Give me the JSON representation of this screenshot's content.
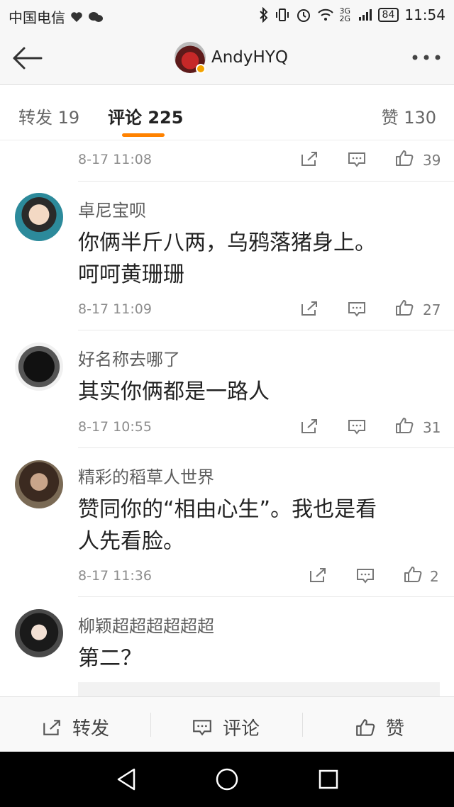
{
  "status_bar": {
    "carrier": "中国电信",
    "network": "3G 2G",
    "battery": "84",
    "time": "11:54"
  },
  "header": {
    "username": "AndyHYQ",
    "back_icon": "arrow-left-icon",
    "more_icon": "more-dots-icon"
  },
  "tabs": {
    "repost": "转发 19",
    "comment": "评论 225",
    "like": "赞 130",
    "accent": "#ff8200"
  },
  "first_partial": {
    "time": "8-17 11:08",
    "likes": "39"
  },
  "comments": [
    {
      "user": "卓尼宝呗",
      "line1": "你俩半斤八两，乌鸦落猪身上。",
      "line2": "呵呵黄珊珊",
      "time": "8-17 11:09",
      "likes": "27"
    },
    {
      "user": "好名称去哪了",
      "line1": "其实你俩都是一路人",
      "line2": "",
      "time": "8-17 10:55",
      "likes": "31"
    },
    {
      "user": "精彩的稻草人世界",
      "line1": "赞同你的“相由心生”。我也是看",
      "line2": "人先看脸。",
      "time": "8-17 11:36",
      "likes": "2"
    },
    {
      "user": "柳颖超超超超超超",
      "line1": "第二？",
      "line2": ""
    }
  ],
  "bottom_bar": {
    "repost": "转发",
    "comment": "评论",
    "like": "赞"
  }
}
